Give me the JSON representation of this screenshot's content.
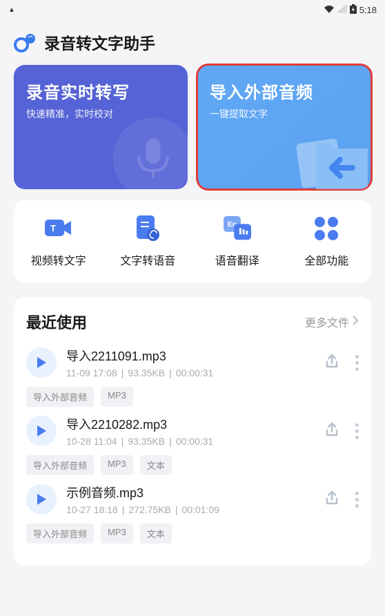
{
  "statusBar": {
    "time": "5:18"
  },
  "header": {
    "title": "录音转文字助手"
  },
  "heroCards": {
    "left": {
      "title": "录音实时转写",
      "subtitle": "快速精准，实时校对"
    },
    "right": {
      "title": "导入外部音频",
      "subtitle": "一键提取文字"
    }
  },
  "features": [
    {
      "label": "视频转文字",
      "icon": "video-text"
    },
    {
      "label": "文字转语音",
      "icon": "text-speech"
    },
    {
      "label": "语音翻译",
      "icon": "voice-translate"
    },
    {
      "label": "全部功能",
      "icon": "all"
    }
  ],
  "recent": {
    "title": "最近使用",
    "moreLabel": "更多文件",
    "items": [
      {
        "name": "导入2211091.mp3",
        "time": "11-09 17:08",
        "size": "93.35KB",
        "duration": "00:00:31",
        "tags": [
          "导入外部音频",
          "MP3"
        ]
      },
      {
        "name": "导入2210282.mp3",
        "time": "10-28 11:04",
        "size": "93.35KB",
        "duration": "00:00:31",
        "tags": [
          "导入外部音频",
          "MP3",
          "文本"
        ]
      },
      {
        "name": "示例音频.mp3",
        "time": "10-27 18:18",
        "size": "272.75KB",
        "duration": "00:01:09",
        "tags": [
          "导入外部音频",
          "MP3",
          "文本"
        ]
      }
    ]
  }
}
